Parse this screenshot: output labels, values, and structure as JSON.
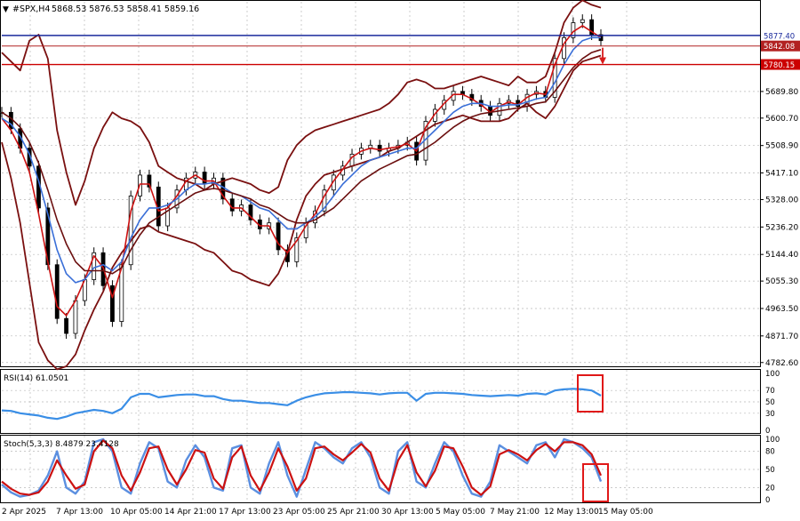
{
  "header": {
    "symbol": "#SPX,H4",
    "ohlc": "5868.53 5876.53 5858.41 5859.16"
  },
  "price_levels": {
    "blue": {
      "label": "5877.40",
      "color": "#1a2a9c"
    },
    "current": {
      "label": "5842.08",
      "color": "#b22222"
    },
    "target": {
      "label": "5780.15",
      "color": "#cc0000"
    }
  },
  "rsi_label": "RSI(14) 61.0501",
  "stoch_label": "Stoch(5,3,3) 8.4879 23.4128",
  "chart_data": [
    {
      "type": "line",
      "panel": "price",
      "y_ticks": [
        "5689.80",
        "5600.70",
        "5508.90",
        "5417.10",
        "5328.00",
        "5236.20",
        "5144.40",
        "5055.30",
        "4963.50",
        "4871.70",
        "4782.60"
      ],
      "ylim": [
        4770,
        5990
      ],
      "x_ticks": [
        "2 Apr 2025",
        "7 Apr 13:00",
        "10 Apr 05:00",
        "14 Apr 21:00",
        "17 Apr 13:00",
        "23 Apr 05:00",
        "25 Apr 21:00",
        "30 Apr 13:00",
        "5 May 05:00",
        "7 May 21:00",
        "12 May 13:00",
        "15 May 05:00"
      ],
      "series": [
        {
          "key": "close",
          "color": "#000000",
          "values": [
            5620,
            5565,
            5500,
            5440,
            5300,
            5110,
            4930,
            4880,
            4990,
            5060,
            5150,
            5040,
            4920,
            5110,
            5340,
            5410,
            5370,
            5240,
            5300,
            5360,
            5400,
            5420,
            5380,
            5400,
            5330,
            5290,
            5310,
            5260,
            5230,
            5250,
            5160,
            5120,
            5200,
            5250,
            5290,
            5360,
            5410,
            5440,
            5480,
            5500,
            5510,
            5490,
            5500,
            5510,
            5520,
            5460,
            5590,
            5630,
            5660,
            5690,
            5680,
            5660,
            5640,
            5610,
            5650,
            5660,
            5640,
            5680,
            5690,
            5670,
            5800,
            5870,
            5920,
            5930,
            5880,
            5860
          ]
        },
        {
          "key": "bb_upper",
          "color": "#7a1010",
          "values": [
            5820,
            5790,
            5760,
            5860,
            5880,
            5800,
            5560,
            5420,
            5310,
            5390,
            5500,
            5570,
            5620,
            5600,
            5590,
            5570,
            5520,
            5440,
            5420,
            5400,
            5390,
            5380,
            5360,
            5380,
            5390,
            5400,
            5390,
            5380,
            5360,
            5350,
            5370,
            5460,
            5510,
            5540,
            5560,
            5570,
            5580,
            5590,
            5600,
            5610,
            5620,
            5630,
            5650,
            5680,
            5720,
            5730,
            5720,
            5700,
            5700,
            5710,
            5720,
            5730,
            5740,
            5730,
            5720,
            5710,
            5740,
            5720,
            5720,
            5740,
            5820,
            5920,
            5970,
            5995,
            5980,
            5970
          ]
        },
        {
          "key": "bb_lower",
          "color": "#7a1010",
          "values": [
            5520,
            5400,
            5250,
            5050,
            4850,
            4790,
            4760,
            4770,
            4810,
            4890,
            4960,
            5020,
            5100,
            5150,
            5190,
            5230,
            5240,
            5220,
            5210,
            5200,
            5190,
            5180,
            5160,
            5150,
            5120,
            5090,
            5080,
            5060,
            5050,
            5040,
            5080,
            5150,
            5260,
            5340,
            5380,
            5410,
            5420,
            5430,
            5440,
            5450,
            5460,
            5470,
            5490,
            5500,
            5520,
            5540,
            5560,
            5580,
            5590,
            5600,
            5610,
            5600,
            5590,
            5590,
            5590,
            5600,
            5630,
            5650,
            5620,
            5600,
            5640,
            5700,
            5760,
            5790,
            5800,
            5810
          ]
        },
        {
          "key": "ema_red",
          "color": "#cc1111",
          "values": [
            5600,
            5560,
            5500,
            5420,
            5280,
            5120,
            4970,
            4940,
            4990,
            5060,
            5140,
            5100,
            5000,
            5100,
            5290,
            5380,
            5380,
            5290,
            5300,
            5340,
            5390,
            5410,
            5390,
            5390,
            5340,
            5300,
            5300,
            5270,
            5240,
            5240,
            5180,
            5150,
            5190,
            5240,
            5280,
            5340,
            5390,
            5430,
            5470,
            5490,
            5500,
            5495,
            5500,
            5505,
            5515,
            5490,
            5570,
            5615,
            5650,
            5680,
            5680,
            5665,
            5645,
            5620,
            5640,
            5655,
            5645,
            5670,
            5685,
            5680,
            5780,
            5850,
            5890,
            5910,
            5890,
            5870
          ]
        },
        {
          "key": "ema_blue",
          "color": "#3a6fd8",
          "values": [
            5600,
            5580,
            5540,
            5480,
            5390,
            5280,
            5160,
            5080,
            5050,
            5060,
            5100,
            5110,
            5090,
            5120,
            5200,
            5260,
            5300,
            5300,
            5310,
            5330,
            5360,
            5380,
            5380,
            5385,
            5370,
            5350,
            5340,
            5320,
            5300,
            5290,
            5260,
            5230,
            5230,
            5250,
            5270,
            5300,
            5340,
            5380,
            5410,
            5440,
            5460,
            5470,
            5480,
            5490,
            5500,
            5500,
            5530,
            5560,
            5590,
            5620,
            5640,
            5650,
            5650,
            5640,
            5640,
            5645,
            5645,
            5655,
            5665,
            5670,
            5720,
            5780,
            5830,
            5860,
            5870,
            5870
          ]
        },
        {
          "key": "ema_mid",
          "color": "#6b0f0f",
          "values": [
            5620,
            5600,
            5570,
            5520,
            5450,
            5360,
            5260,
            5180,
            5120,
            5090,
            5090,
            5090,
            5080,
            5100,
            5160,
            5210,
            5250,
            5270,
            5290,
            5310,
            5330,
            5350,
            5360,
            5365,
            5360,
            5350,
            5340,
            5330,
            5310,
            5300,
            5280,
            5260,
            5250,
            5250,
            5260,
            5280,
            5300,
            5330,
            5360,
            5390,
            5410,
            5430,
            5445,
            5460,
            5475,
            5480,
            5500,
            5520,
            5545,
            5570,
            5590,
            5605,
            5615,
            5620,
            5625,
            5630,
            5635,
            5640,
            5650,
            5655,
            5690,
            5730,
            5770,
            5800,
            5820,
            5830
          ]
        }
      ]
    },
    {
      "type": "line",
      "panel": "rsi",
      "y_ticks": [
        "100",
        "70",
        "50",
        "30",
        "0"
      ],
      "ylim": [
        0,
        100
      ],
      "series": [
        {
          "key": "rsi",
          "color": "#3a8ee6",
          "values": [
            35,
            34,
            30,
            28,
            26,
            22,
            20,
            24,
            30,
            33,
            36,
            34,
            30,
            38,
            58,
            64,
            64,
            58,
            60,
            62,
            63,
            63,
            60,
            60,
            55,
            52,
            52,
            50,
            48,
            48,
            46,
            44,
            52,
            58,
            62,
            65,
            66,
            67,
            67,
            66,
            65,
            63,
            65,
            66,
            66,
            52,
            64,
            66,
            66,
            65,
            64,
            62,
            61,
            60,
            61,
            62,
            61,
            64,
            65,
            63,
            70,
            72,
            73,
            72,
            70,
            61
          ]
        }
      ]
    },
    {
      "type": "line",
      "panel": "stoch",
      "y_ticks": [
        "100",
        "80",
        "50",
        "20",
        "0"
      ],
      "ylim": [
        0,
        100
      ],
      "series": [
        {
          "key": "main",
          "color": "#5b8fe0",
          "values": [
            25,
            12,
            5,
            8,
            15,
            40,
            80,
            20,
            10,
            30,
            95,
            100,
            80,
            20,
            10,
            60,
            95,
            85,
            30,
            20,
            65,
            90,
            70,
            20,
            15,
            85,
            90,
            20,
            10,
            60,
            95,
            40,
            5,
            50,
            95,
            85,
            70,
            60,
            85,
            95,
            70,
            20,
            10,
            80,
            95,
            30,
            20,
            60,
            95,
            80,
            40,
            10,
            5,
            30,
            90,
            80,
            70,
            60,
            90,
            95,
            70,
            100,
            95,
            85,
            70,
            30
          ]
        },
        {
          "key": "signal",
          "color": "#cc1111",
          "values": [
            30,
            18,
            10,
            8,
            12,
            30,
            65,
            40,
            18,
            25,
            80,
            98,
            85,
            40,
            15,
            45,
            85,
            88,
            50,
            25,
            50,
            82,
            78,
            35,
            18,
            70,
            88,
            40,
            15,
            45,
            85,
            55,
            15,
            35,
            85,
            88,
            75,
            65,
            78,
            92,
            78,
            35,
            15,
            65,
            90,
            45,
            22,
            48,
            88,
            85,
            55,
            20,
            8,
            22,
            75,
            82,
            75,
            65,
            82,
            92,
            80,
            95,
            95,
            90,
            75,
            40
          ]
        }
      ]
    }
  ]
}
